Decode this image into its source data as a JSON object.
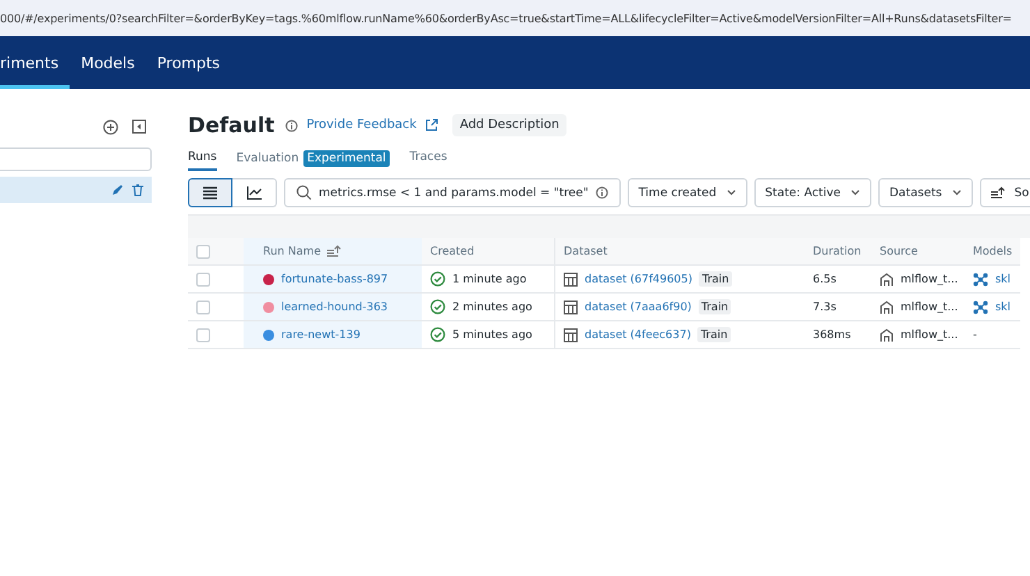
{
  "address_bar": {
    "url": "000/#/experiments/0?searchFilter=&orderByKey=tags.%60mlflow.runName%60&orderByAsc=true&startTime=ALL&lifecycleFilter=Active&modelVersionFilter=All+Runs&datasetsFilter="
  },
  "nav": [
    {
      "label": "riments",
      "selected": true
    },
    {
      "label": "Models",
      "selected": false
    },
    {
      "label": "Prompts",
      "selected": false
    }
  ],
  "experiment": {
    "title": "Default",
    "feedback_link": "Provide Feedback",
    "add_description": "Add Description"
  },
  "tabs": [
    {
      "label": "Runs",
      "selected": true
    },
    {
      "label": "Evaluation",
      "selected": false,
      "badge": "Experimental"
    },
    {
      "label": "Traces",
      "selected": false
    }
  ],
  "toolbar": {
    "view_modes": [
      {
        "kind": "table",
        "selected": true
      },
      {
        "kind": "chart",
        "selected": false
      }
    ],
    "search": {
      "value": "metrics.rmse < 1 and params.model = \"tree\""
    },
    "filters": [
      "Time created",
      "State: Active",
      "Datasets"
    ],
    "sort_label": "So"
  },
  "table": {
    "select_all": {
      "checked": false
    },
    "columns": [
      "Run Name",
      "Created",
      "Dataset",
      "Duration",
      "Source",
      "Models"
    ],
    "rows": [
      {
        "checked": false,
        "name": "fortunate-bass-897",
        "color": "#c8234a",
        "created": "1 minute ago",
        "dataset": "dataset (67f49605)",
        "tag": "Train",
        "duration": "6.5s",
        "source": "mlflow_t...",
        "model": "skl"
      },
      {
        "checked": false,
        "name": "learned-hound-363",
        "color": "#f08ea0",
        "created": "2 minutes ago",
        "dataset": "dataset (7aaa6f90)",
        "tag": "Train",
        "duration": "7.3s",
        "source": "mlflow_t...",
        "model": "skl"
      },
      {
        "checked": false,
        "name": "rare-newt-139",
        "color": "#3a8ee0",
        "created": "5 minutes ago",
        "dataset": "dataset (4feec637)",
        "tag": "Train",
        "duration": "368ms",
        "source": "mlflow_t...",
        "model": "-"
      }
    ]
  }
}
